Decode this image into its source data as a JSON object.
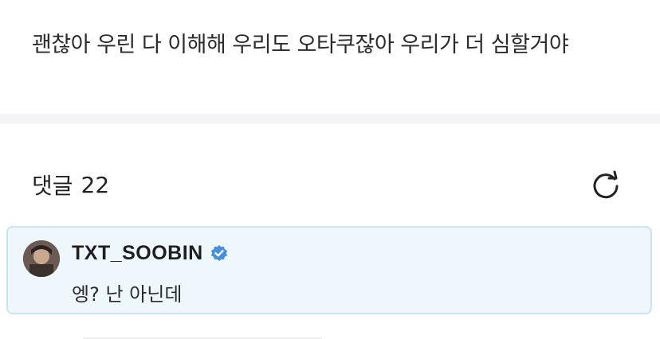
{
  "post": {
    "text": "괜찮아 우린 다 이해해 우리도 오타쿠잖아 우리가 더 심할거야"
  },
  "comments": {
    "label": "댓글",
    "count": "22",
    "refresh_icon": "refresh-icon",
    "items": [
      {
        "username": "TXT_SOOBIN",
        "verified_icon": "verified-badge-icon",
        "text": "엥? 난 아닌데"
      }
    ]
  },
  "colors": {
    "verified": "#4a90d9",
    "card_bg": "#eef7fc",
    "card_border": "#cbe3ee"
  }
}
